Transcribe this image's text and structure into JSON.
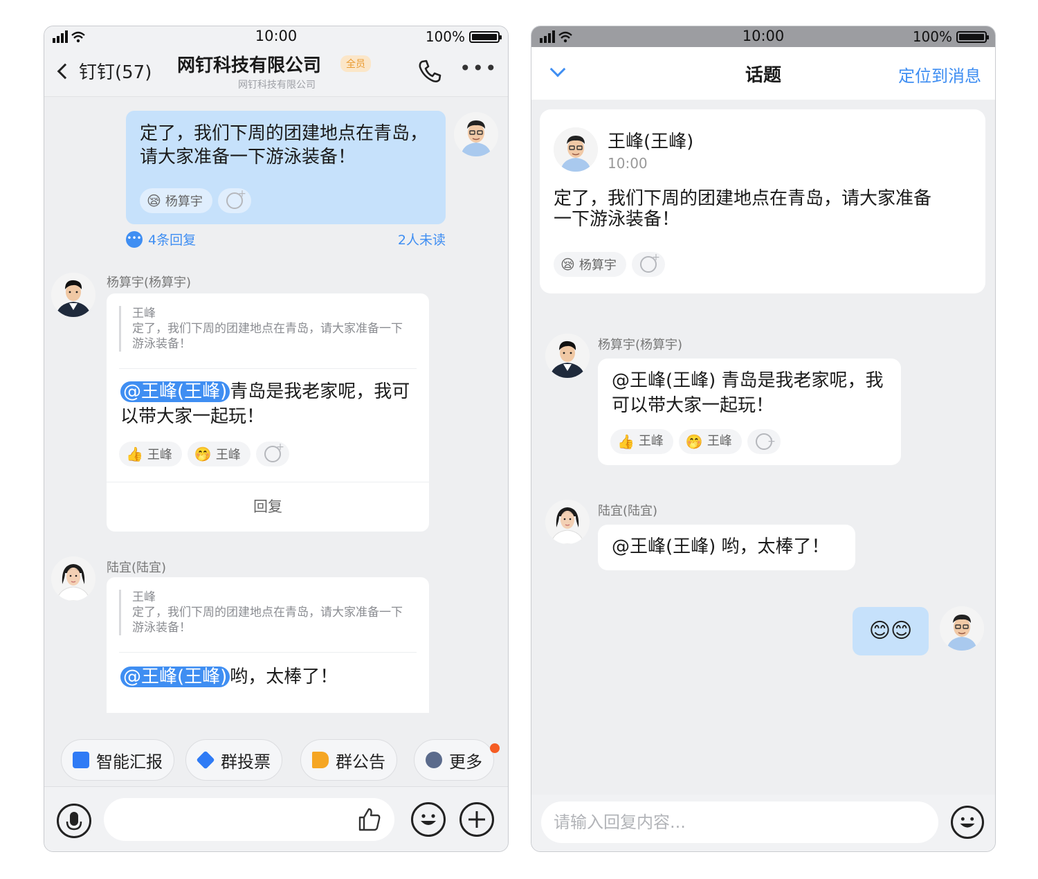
{
  "status": {
    "time": "10:00",
    "battery": "100%"
  },
  "left": {
    "header": {
      "back_label": "钉钉(57)",
      "title": "网钉科技有限公司",
      "badge": "全员",
      "subtitle": "网钉科技有限公司"
    },
    "my_message": {
      "text": "定了，我们下周的团建地点在青岛，请大家准备一下游泳装备！",
      "reaction_name": "杨算宇",
      "reaction_emoji": "😪",
      "replies": "4条回复",
      "unread": "2人未读"
    },
    "msg1": {
      "sender": "杨算宇(杨算宇)",
      "quote_name": "王峰",
      "quote_text": "定了，我们下周的团建地点在青岛，请大家准备一下游泳装备！",
      "mention": "@王峰(王峰)",
      "text": "青岛是我老家呢，我可以带大家一起玩！",
      "reactions": [
        {
          "emoji": "👍",
          "name": "王峰"
        },
        {
          "emoji": "🤭",
          "name": "王峰"
        }
      ],
      "reply_label": "回复"
    },
    "msg2": {
      "sender": "陆宜(陆宜)",
      "quote_name": "王峰",
      "quote_text": "定了，我们下周的团建地点在青岛，请大家准备一下游泳装备！",
      "mention": "@王峰(王峰)",
      "text": "哟，太棒了！"
    },
    "toolbar": [
      {
        "label": "智能汇报",
        "icon": "report-icon",
        "color": "#2f7bf5"
      },
      {
        "label": "群投票",
        "icon": "vote-icon",
        "color": "#2f7bf5"
      },
      {
        "label": "群公告",
        "icon": "announce-icon",
        "color": "#f5a623"
      },
      {
        "label": "更多",
        "icon": "more-icon",
        "color": "#5b6b8c"
      }
    ]
  },
  "right": {
    "header": {
      "title": "话题",
      "locate": "定位到消息"
    },
    "topic": {
      "name": "王峰(王峰)",
      "time": "10:00",
      "text": "定了，我们下周的团建地点在青岛，请大家准备一下游泳装备！",
      "reaction_name": "杨算宇",
      "reaction_emoji": "😪"
    },
    "reply1": {
      "sender": "杨算宇(杨算宇)",
      "text": "@王峰(王峰) 青岛是我老家呢，我可以带大家一起玩！",
      "reactions": [
        {
          "emoji": "👍",
          "name": "王峰"
        },
        {
          "emoji": "🤭",
          "name": "王峰"
        }
      ]
    },
    "reply2": {
      "sender": "陆宜(陆宜)",
      "text": "@王峰(王峰) 哟，太棒了！"
    },
    "my_reply": {
      "text": "😊😊"
    },
    "input": {
      "placeholder": "请输入回复内容..."
    }
  }
}
